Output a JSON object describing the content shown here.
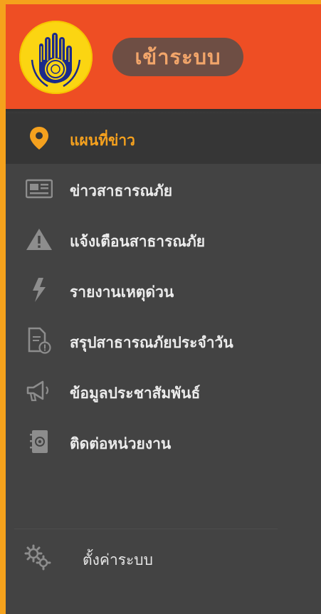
{
  "header": {
    "login_label": "เข้าระบบ",
    "colors": {
      "header_bg": "#ee4e24",
      "pill_bg": "#6e4e44",
      "pill_text": "#f2a56a",
      "drawer_bg": "#434343",
      "accent": "#f5a11e"
    },
    "logo_icon": "hand-emblem-logo"
  },
  "menu": {
    "items": [
      {
        "label": "แผนที่ข่าว",
        "icon": "map-pin-icon",
        "active": true
      },
      {
        "label": "ข่าวสาธารณภัย",
        "icon": "newspaper-icon",
        "active": false
      },
      {
        "label": "แจ้งเตือนสาธารณภัย",
        "icon": "warning-icon",
        "active": false
      },
      {
        "label": "รายงานเหตุด่วน",
        "icon": "lightning-icon",
        "active": false
      },
      {
        "label": "สรุปสาธารณภัยประจำวัน",
        "icon": "report-document-icon",
        "active": false
      },
      {
        "label": "ข้อมูลประชาสัมพันธ์",
        "icon": "megaphone-icon",
        "active": false
      },
      {
        "label": "ติดต่อหน่วยงาน",
        "icon": "contact-book-icon",
        "active": false
      }
    ]
  },
  "settings": {
    "label": "ตั้งค่าระบบ",
    "icon": "gears-icon"
  }
}
